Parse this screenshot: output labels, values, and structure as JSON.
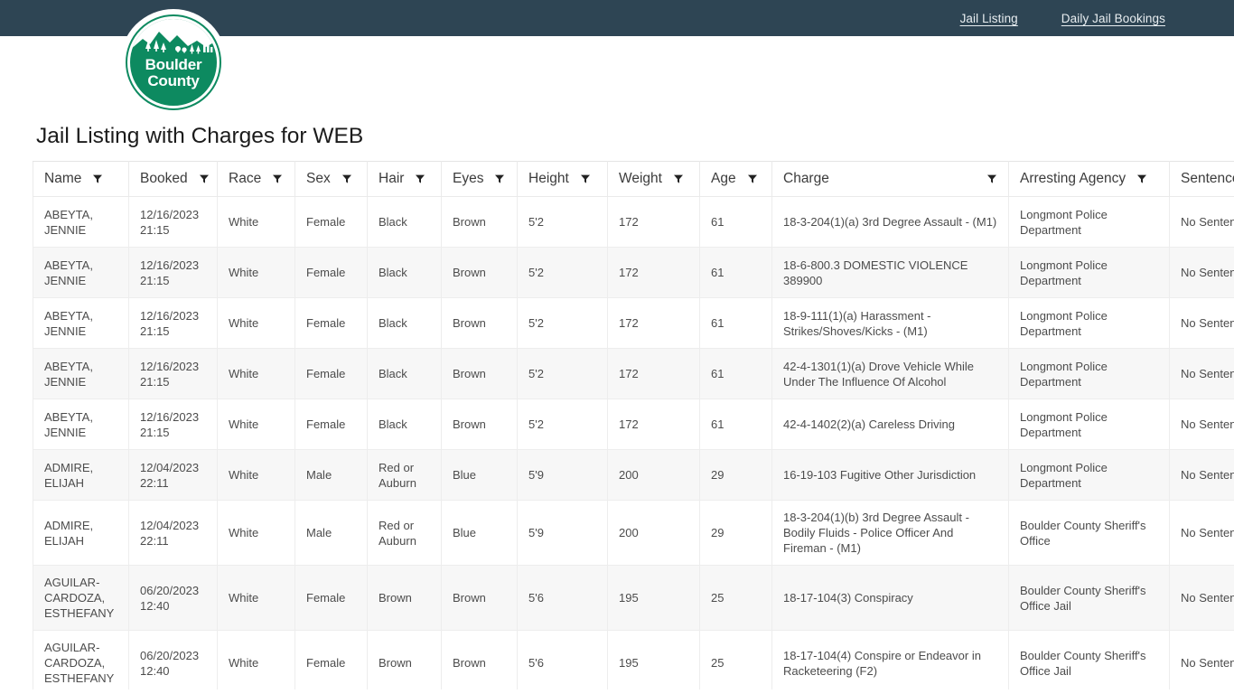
{
  "topbar": {
    "links": [
      {
        "label": "Jail Listing",
        "name": "nav-link-jail-listing"
      },
      {
        "label": "Daily Jail Bookings",
        "name": "nav-link-daily-jail-bookings"
      }
    ],
    "background_color": "#2e4554",
    "link_color": "#e9eef1"
  },
  "logo": {
    "line1": "Boulder",
    "line2": "County",
    "brand_color": "#0d8a60",
    "icon": "boulder-county-mountain-logo"
  },
  "page": {
    "title": "Jail Listing with Charges for WEB"
  },
  "table": {
    "filter_icon": "filter-funnel-icon",
    "columns": [
      {
        "label": "Name",
        "key": "name",
        "filter": true
      },
      {
        "label": "Booked",
        "key": "booked",
        "filter": true
      },
      {
        "label": "Race",
        "key": "race",
        "filter": true
      },
      {
        "label": "Sex",
        "key": "sex",
        "filter": true
      },
      {
        "label": "Hair",
        "key": "hair",
        "filter": true
      },
      {
        "label": "Eyes",
        "key": "eyes",
        "filter": true
      },
      {
        "label": "Height",
        "key": "height",
        "filter": true
      },
      {
        "label": "Weight",
        "key": "weight",
        "filter": true
      },
      {
        "label": "Age",
        "key": "age",
        "filter": true
      },
      {
        "label": "Charge",
        "key": "charge",
        "filter": true
      },
      {
        "label": "Arresting Agency",
        "key": "agency",
        "filter": true
      },
      {
        "label": "Sentence",
        "key": "sentence",
        "filter": false
      }
    ],
    "rows": [
      {
        "name": "ABEYTA, JENNIE",
        "booked": "12/16/2023 21:15",
        "race": "White",
        "sex": "Female",
        "hair": "Black",
        "eyes": "Brown",
        "height": "5'2",
        "weight": "172",
        "age": "61",
        "charge": "18-3-204(1)(a) 3rd Degree Assault - (M1)",
        "agency": "Longmont Police Department",
        "sentence": "No Sentence"
      },
      {
        "name": "ABEYTA, JENNIE",
        "booked": "12/16/2023 21:15",
        "race": "White",
        "sex": "Female",
        "hair": "Black",
        "eyes": "Brown",
        "height": "5'2",
        "weight": "172",
        "age": "61",
        "charge": "18-6-800.3 DOMESTIC VIOLENCE 389900",
        "agency": "Longmont Police Department",
        "sentence": "No Sentence"
      },
      {
        "name": "ABEYTA, JENNIE",
        "booked": "12/16/2023 21:15",
        "race": "White",
        "sex": "Female",
        "hair": "Black",
        "eyes": "Brown",
        "height": "5'2",
        "weight": "172",
        "age": "61",
        "charge": "18-9-111(1)(a) Harassment - Strikes/Shoves/Kicks - (M1)",
        "agency": "Longmont Police Department",
        "sentence": "No Sentence"
      },
      {
        "name": "ABEYTA, JENNIE",
        "booked": "12/16/2023 21:15",
        "race": "White",
        "sex": "Female",
        "hair": "Black",
        "eyes": "Brown",
        "height": "5'2",
        "weight": "172",
        "age": "61",
        "charge": "42-4-1301(1)(a) Drove Vehicle While Under The Influence Of Alcohol",
        "agency": "Longmont Police Department",
        "sentence": "No Sentence"
      },
      {
        "name": "ABEYTA, JENNIE",
        "booked": "12/16/2023 21:15",
        "race": "White",
        "sex": "Female",
        "hair": "Black",
        "eyes": "Brown",
        "height": "5'2",
        "weight": "172",
        "age": "61",
        "charge": "42-4-1402(2)(a) Careless Driving",
        "agency": "Longmont Police Department",
        "sentence": "No Sentence"
      },
      {
        "name": "ADMIRE, ELIJAH",
        "booked": "12/04/2023 22:11",
        "race": "White",
        "sex": "Male",
        "hair": "Red or Auburn",
        "eyes": "Blue",
        "height": "5'9",
        "weight": "200",
        "age": "29",
        "charge": "16-19-103 Fugitive Other Jurisdiction",
        "agency": "Longmont Police Department",
        "sentence": "No Sentence"
      },
      {
        "name": "ADMIRE, ELIJAH",
        "booked": "12/04/2023 22:11",
        "race": "White",
        "sex": "Male",
        "hair": "Red or Auburn",
        "eyes": "Blue",
        "height": "5'9",
        "weight": "200",
        "age": "29",
        "charge": "18-3-204(1)(b) 3rd Degree Assault - Bodily Fluids - Police Officer And Fireman - (M1)",
        "agency": "Boulder County Sheriff's Office",
        "sentence": "No Sentence"
      },
      {
        "name": "AGUILAR-CARDOZA, ESTHEFANY",
        "booked": "06/20/2023 12:40",
        "race": "White",
        "sex": "Female",
        "hair": "Brown",
        "eyes": "Brown",
        "height": "5'6",
        "weight": "195",
        "age": "25",
        "charge": "18-17-104(3) Conspiracy",
        "agency": "Boulder County Sheriff's Office Jail",
        "sentence": "No Sentence"
      },
      {
        "name": "AGUILAR-CARDOZA, ESTHEFANY",
        "booked": "06/20/2023 12:40",
        "race": "White",
        "sex": "Female",
        "hair": "Brown",
        "eyes": "Brown",
        "height": "5'6",
        "weight": "195",
        "age": "25",
        "charge": "18-17-104(4) Conspire or Endeavor in Racketeering (F2)",
        "agency": "Boulder County Sheriff's Office Jail",
        "sentence": "No Sentence"
      }
    ]
  }
}
